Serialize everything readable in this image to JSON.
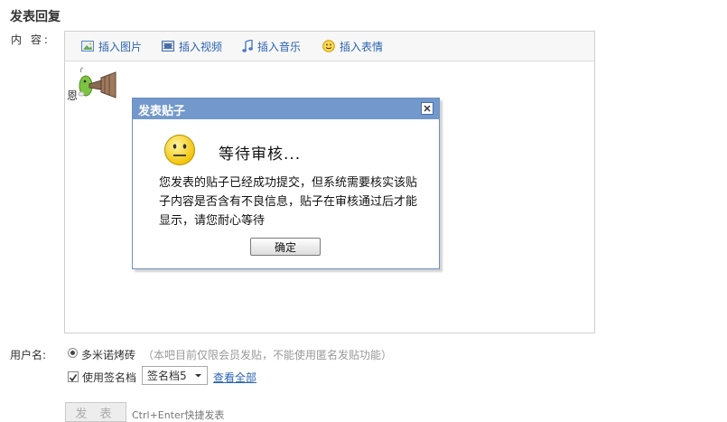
{
  "form": {
    "title": "发表回复",
    "content_label": "内 容:"
  },
  "toolbar": {
    "insert_image": "插入图片",
    "insert_video": "插入视频",
    "insert_music": "插入音乐",
    "insert_emoticon": "插入表情"
  },
  "editor": {
    "text": "恩"
  },
  "dialog": {
    "title": "发表贴子",
    "heading": "等待审核...",
    "message": "您发表的贴子已经成功提交，但系统需要核实该贴子内容是否含有不良信息，贴子在审核通过后才能显示，请您耐心等待",
    "confirm_label": "确定"
  },
  "user": {
    "label": "用户名:",
    "name": "多米诺烤砖",
    "hint": "（本吧目前仅限会员发贴，不能使用匿名发贴功能）"
  },
  "signature": {
    "checkbox_label": "使用签名档",
    "selected": "签名档5",
    "view_all": "查看全部"
  },
  "submit": {
    "label": "发 表",
    "shortcut_hint": "Ctrl+Enter快捷发表"
  },
  "colors": {
    "link": "#2d64b3",
    "dialog_header": "#7298cc"
  }
}
